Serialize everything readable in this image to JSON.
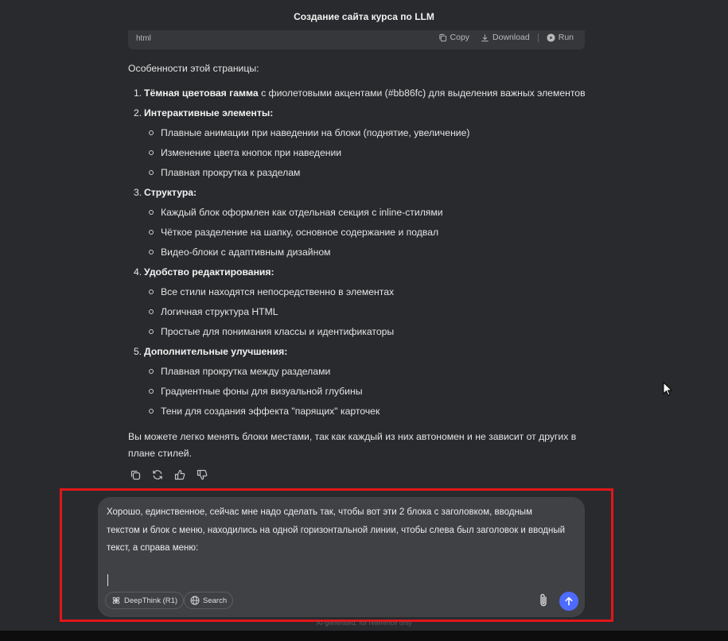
{
  "title": "Создание сайта курса по LLM",
  "code_block": {
    "language": "html",
    "copy_label": "Copy",
    "download_label": "Download",
    "run_label": "Run"
  },
  "answer": {
    "intro": "Особенности этой страницы:",
    "items": [
      {
        "number": "1.",
        "heading": "Тёмная цветовая гамма",
        "text": " с фиолетовыми акцентами (#bb86fc) для выделения важных элементов",
        "sub": []
      },
      {
        "number": "2.",
        "heading": "Интерактивные элементы:",
        "text": "",
        "sub": [
          "Плавные анимации при наведении на блоки (поднятие, увеличение)",
          "Изменение цвета кнопок при наведении",
          "Плавная прокрутка к разделам"
        ]
      },
      {
        "number": "3.",
        "heading": "Структура:",
        "text": "",
        "sub": [
          "Каждый блок оформлен как отдельная секция с inline-стилями",
          "Чёткое разделение на шапку, основное содержание и подвал",
          "Видео-блоки с адаптивным дизайном"
        ]
      },
      {
        "number": "4.",
        "heading": "Удобство редактирования:",
        "text": "",
        "sub": [
          "Все стили находятся непосредственно в элементах",
          "Логичная структура HTML",
          "Простые для понимания классы и идентификаторы"
        ]
      },
      {
        "number": "5.",
        "heading": "Дополнительные улучшения:",
        "text": "",
        "sub": [
          "Плавная прокрутка между разделами",
          "Градиентные фоны для визуальной глубины",
          "Тени для создания эффекта \"парящих\" карточек"
        ]
      }
    ],
    "outro": "Вы можете легко менять блоки местами, так как каждый из них автономен и не зависит от других в плане стилей."
  },
  "composer": {
    "text": "Хорошо, единственное, сейчас мне надо сделать так, чтобы вот эти 2 блока с заголовком, вводным текстом и блок с меню, находились на одной горизонтальной линии, чтобы слева был заголовок и вводный текст, а справа меню:",
    "deepthink_label": "DeepThink (R1)",
    "search_label": "Search"
  },
  "footer_note": "AI-generated, for reference only",
  "colors": {
    "background": "#292a2d",
    "composer": "#404145",
    "send_button": "#4d6bfe",
    "highlight_border": "#e0161b"
  },
  "icons": [
    "copy-icon",
    "download-icon",
    "run-icon",
    "regenerate-icon",
    "thumbs-up-icon",
    "thumbs-down-icon",
    "atom-icon",
    "globe-icon",
    "paperclip-icon",
    "arrow-up-icon",
    "mouse-pointer-icon"
  ]
}
